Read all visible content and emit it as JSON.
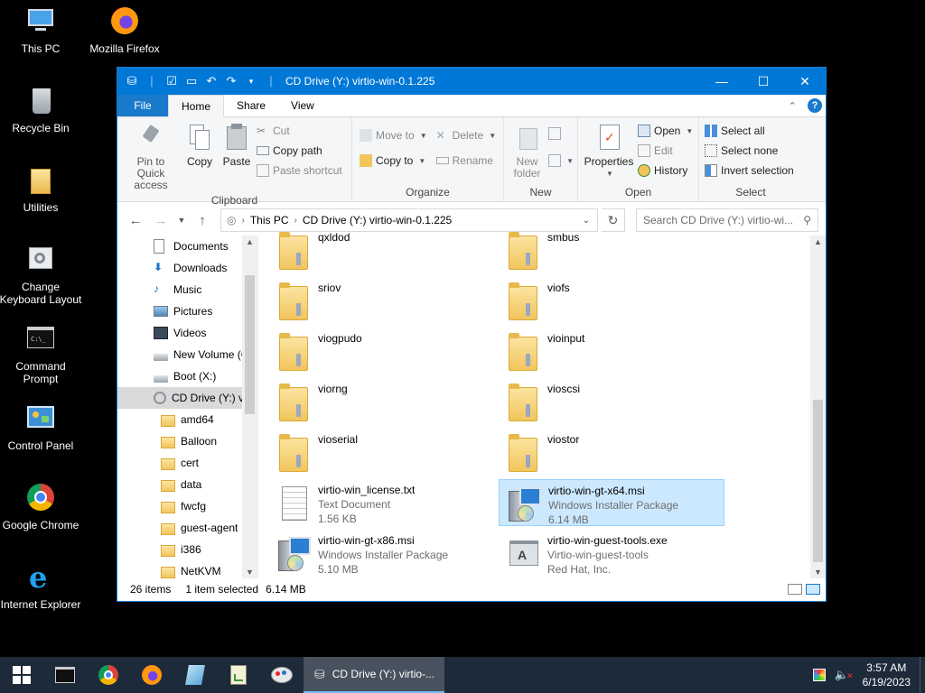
{
  "desktop": {
    "icons": [
      {
        "label": "This PC"
      },
      {
        "label": "Mozilla Firefox"
      },
      {
        "label": "Recycle Bin"
      },
      {
        "label": "Utilities"
      },
      {
        "label": "Change Keyboard Layout"
      },
      {
        "label": "Command Prompt"
      },
      {
        "label": "Control Panel"
      },
      {
        "label": "Google Chrome"
      },
      {
        "label": "Internet Explorer"
      }
    ]
  },
  "window": {
    "title": "CD Drive (Y:) virtio-win-0.1.225",
    "tabs": {
      "file": "File",
      "home": "Home",
      "share": "Share",
      "view": "View"
    },
    "help": "?",
    "ribbon": {
      "clipboard": {
        "name": "Clipboard",
        "pin": "Pin to Quick access",
        "copy": "Copy",
        "paste": "Paste",
        "cut": "Cut",
        "copy_path": "Copy path",
        "paste_shortcut": "Paste shortcut"
      },
      "organize": {
        "name": "Organize",
        "move_to": "Move to",
        "copy_to": "Copy to",
        "delete": "Delete",
        "rename": "Rename"
      },
      "new": {
        "name": "New",
        "new_folder": "New folder"
      },
      "open": {
        "name": "Open",
        "properties": "Properties",
        "open": "Open",
        "edit": "Edit",
        "history": "History"
      },
      "select": {
        "name": "Select",
        "select_all": "Select all",
        "select_none": "Select none",
        "invert": "Invert selection"
      }
    },
    "address": {
      "crumb1": "This PC",
      "crumb2": "CD Drive (Y:) virtio-win-0.1.225",
      "search_placeholder": "Search CD Drive (Y:) virtio-wi..."
    },
    "nav": [
      {
        "label": "Documents",
        "icon": "documents-icon"
      },
      {
        "label": "Downloads",
        "icon": "downloads-icon"
      },
      {
        "label": "Music",
        "icon": "music-icon"
      },
      {
        "label": "Pictures",
        "icon": "pictures-icon"
      },
      {
        "label": "Videos",
        "icon": "videos-icon"
      },
      {
        "label": "New Volume (C",
        "icon": "drive-icon"
      },
      {
        "label": "Boot (X:)",
        "icon": "drive-icon"
      },
      {
        "label": "CD Drive (Y:) vi",
        "icon": "cd-drive-icon"
      },
      {
        "label": "amd64",
        "icon": "folder-icon"
      },
      {
        "label": "Balloon",
        "icon": "folder-icon"
      },
      {
        "label": "cert",
        "icon": "folder-icon"
      },
      {
        "label": "data",
        "icon": "folder-icon"
      },
      {
        "label": "fwcfg",
        "icon": "folder-icon"
      },
      {
        "label": "guest-agent",
        "icon": "folder-icon"
      },
      {
        "label": "i386",
        "icon": "folder-icon"
      },
      {
        "label": "NetKVM",
        "icon": "folder-icon"
      }
    ],
    "files": [
      {
        "name": "qxldod",
        "type": "folder"
      },
      {
        "name": "smbus",
        "type": "folder"
      },
      {
        "name": "sriov",
        "type": "folder"
      },
      {
        "name": "viofs",
        "type": "folder"
      },
      {
        "name": "viogpudo",
        "type": "folder"
      },
      {
        "name": "vioinput",
        "type": "folder"
      },
      {
        "name": "viorng",
        "type": "folder"
      },
      {
        "name": "vioscsi",
        "type": "folder"
      },
      {
        "name": "vioserial",
        "type": "folder"
      },
      {
        "name": "viostor",
        "type": "folder"
      },
      {
        "name": "virtio-win_license.txt",
        "line2": "Text Document",
        "line3": "1.56 KB",
        "type": "text"
      },
      {
        "name": "virtio-win-gt-x64.msi",
        "line2": "Windows Installer Package",
        "line3": "6.14 MB",
        "type": "msi"
      },
      {
        "name": "virtio-win-gt-x86.msi",
        "line2": "Windows Installer Package",
        "line3": "5.10 MB",
        "type": "msi"
      },
      {
        "name": "virtio-win-guest-tools.exe",
        "line2": "Virtio-win-guest-tools",
        "line3": "Red Hat, Inc.",
        "type": "exe"
      }
    ],
    "status": {
      "count": "26 items",
      "selected": "1 item selected",
      "size": "6.14 MB"
    }
  },
  "taskbar": {
    "window_label": "CD Drive (Y:) virtio-...",
    "time": "3:57 AM",
    "date": "6/19/2023"
  },
  "colors": {
    "accent": "#0078d7",
    "selection": "#cce8ff",
    "taskbar": "#1c2a3a"
  }
}
